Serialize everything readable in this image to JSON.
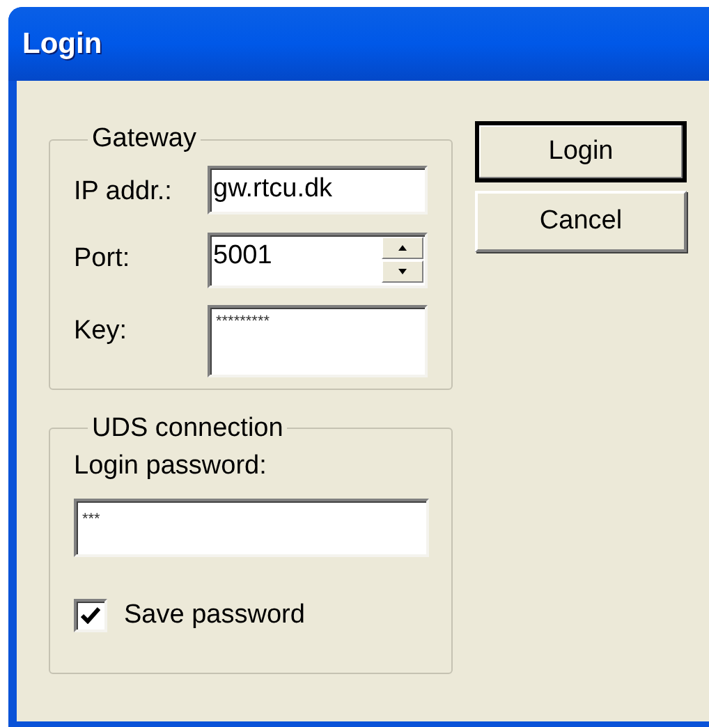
{
  "window": {
    "title": "Login"
  },
  "gateway": {
    "legend": "Gateway",
    "fields": [
      {
        "label": "IP addr.:",
        "value": "gw.rtcu.dk",
        "kind": "text"
      },
      {
        "label": "Port:",
        "value": "5001",
        "kind": "spin"
      },
      {
        "label": "Key:",
        "value": "*********",
        "kind": "masked"
      }
    ]
  },
  "buttons": [
    {
      "label": "Login",
      "default": true
    },
    {
      "label": "Cancel",
      "default": false
    }
  ],
  "uds": {
    "legend": "UDS connection",
    "password_label": "Login password:",
    "password_value": "***",
    "save_password": {
      "label": "Save password",
      "checked": true
    }
  }
}
